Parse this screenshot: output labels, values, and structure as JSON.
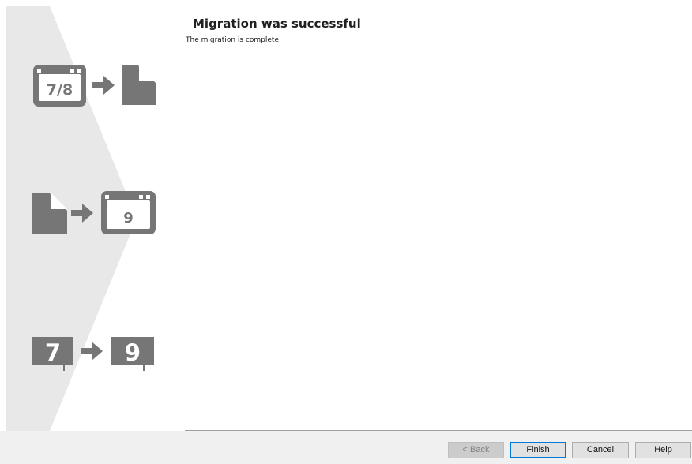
{
  "page": {
    "heading": "Migration was successful",
    "description": "The migration is complete."
  },
  "side_panel": {
    "steps": [
      {
        "name": "version-to-file",
        "from_label": "7/8"
      },
      {
        "name": "file-to-version",
        "to_label": "9"
      },
      {
        "name": "version-upgrade",
        "from_label": "7",
        "to_label": "9"
      }
    ]
  },
  "footer": {
    "back_label": "< Back",
    "finish_label": "Finish",
    "cancel_label": "Cancel",
    "help_label": "Help"
  },
  "colors": {
    "panel_background": "#e8e8e8",
    "icon_gray": "#767676",
    "footer_background": "#f0f0f0",
    "primary_button_border": "#0078d7"
  }
}
